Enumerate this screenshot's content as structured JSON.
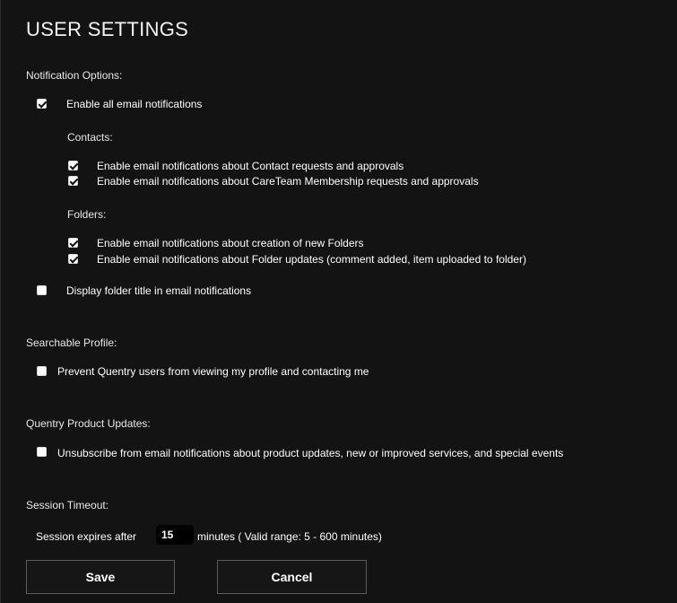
{
  "title": "USER SETTINGS",
  "notification_options": {
    "heading": "Notification Options:",
    "enable_all": {
      "label": "Enable all email notifications",
      "checked": true
    },
    "contacts": {
      "heading": "Contacts:",
      "items": [
        {
          "label": "Enable email notifications about Contact requests and approvals",
          "checked": true
        },
        {
          "label": "Enable email notifications about CareTeam Membership requests and approvals",
          "checked": true
        }
      ]
    },
    "folders": {
      "heading": "Folders:",
      "items": [
        {
          "label": "Enable email notifications about creation of new Folders",
          "checked": true
        },
        {
          "label": "Enable email notifications about Folder updates (comment added, item uploaded to folder)",
          "checked": true
        }
      ]
    },
    "display_folder_title": {
      "label": "Display folder title in email notifications",
      "checked": false
    }
  },
  "searchable_profile": {
    "heading": "Searchable Profile:",
    "prevent": {
      "label": "Prevent Quentry users from viewing my profile and contacting me",
      "checked": false
    }
  },
  "product_updates": {
    "heading": "Quentry Product Updates:",
    "unsubscribe": {
      "label": "Unsubscribe from email notifications about product updates, new or improved services, and special events",
      "checked": false
    }
  },
  "session_timeout": {
    "heading": "Session Timeout:",
    "prefix": "Session expires after",
    "value": "15",
    "suffix": "minutes ( Valid range: 5 - 600 minutes)"
  },
  "buttons": {
    "save": "Save",
    "cancel": "Cancel"
  }
}
